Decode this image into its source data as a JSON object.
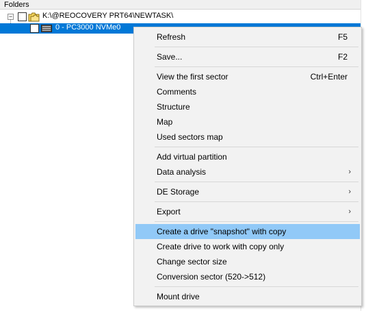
{
  "panel": {
    "header": "Folders"
  },
  "tree": {
    "root_expander": "−",
    "root_label": "K:\\@REOCOVERY PRT64\\NEWTASK\\",
    "child_label": "0 - PC3000 NVMe0"
  },
  "menu": {
    "refresh": {
      "label": "Refresh",
      "shortcut": "F5"
    },
    "save": {
      "label": "Save...",
      "shortcut": "F2"
    },
    "view_first_sector": {
      "label": "View the first sector",
      "shortcut": "Ctrl+Enter"
    },
    "comments": {
      "label": "Comments"
    },
    "structure": {
      "label": "Structure"
    },
    "map": {
      "label": "Map"
    },
    "used_sectors_map": {
      "label": "Used sectors map"
    },
    "add_virtual_partition": {
      "label": "Add virtual partition"
    },
    "data_analysis": {
      "label": "Data analysis",
      "arrow": "›"
    },
    "de_storage": {
      "label": "DE Storage",
      "arrow": "›"
    },
    "export": {
      "label": "Export",
      "arrow": "›"
    },
    "create_snapshot": {
      "label": "Create a drive \"snapshot\" with copy"
    },
    "create_copy_only": {
      "label": "Create drive to work with copy only"
    },
    "change_sector_size": {
      "label": "Change sector size"
    },
    "conversion_sector": {
      "label": "Conversion sector (520->512)"
    },
    "mount_drive": {
      "label": "Mount drive"
    }
  },
  "colors": {
    "selection": "#0078d7",
    "menu_highlight": "#91c9f7",
    "menu_background": "#f2f2f2"
  }
}
